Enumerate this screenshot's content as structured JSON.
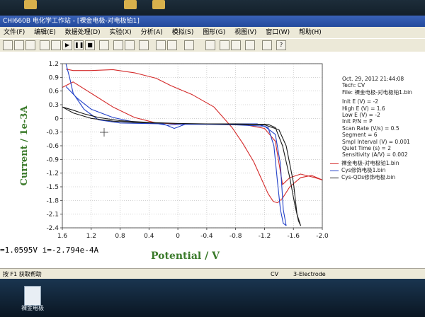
{
  "window": {
    "title": "CHI660B 电化学工作站 - [裸金电极-对电极铂1]",
    "menu": [
      "文件(F)",
      "编辑(E)",
      "数据处理(D)",
      "实验(X)",
      "分析(A)",
      "模拟(S)",
      "图形(G)",
      "视图(V)",
      "窗口(W)",
      "帮助(H)"
    ]
  },
  "info": {
    "date": "Oct. 29, 2012   21:44:08",
    "tech": "Tech: CV",
    "file": "File: 裸金电极-对电极铂1.bin",
    "params": [
      "Init E (V) = -2",
      "High E (V) = 1.6",
      "Low E (V) = -2",
      "Init P/N = P",
      "Scan Rate (V/s) = 0.5",
      "Segment = 6",
      "Smpl Interval (V) = 0.001",
      "Quiet Time (s) = 2",
      "Sensitivity (A/V) = 0.002"
    ]
  },
  "status": {
    "readout": "=1.0595V  i=-2.794e-4A",
    "help": "按 F1 获取帮助",
    "mode": "CV",
    "electrode": "3-Electrode"
  },
  "taskbar": {
    "item_label": "裸金电极"
  },
  "colors": {
    "red": "#d42a2a",
    "blue": "#2140c8",
    "black": "#1a1a1a",
    "axis_label": "#3a7a2a"
  },
  "chart_data": {
    "type": "line",
    "xlabel": "Potential / V",
    "ylabel": "Current / 1e-3A",
    "xlim": [
      1.6,
      -2.0
    ],
    "ylim": [
      -2.4,
      1.2
    ],
    "x_reversed": true,
    "grid": true,
    "xticks": [
      1.6,
      1.2,
      0.8,
      0.4,
      0,
      -0.4,
      -0.8,
      -1.2,
      -1.6,
      -2.0
    ],
    "xtick_labels": [
      "1.6",
      "1.2",
      "0.8",
      "0.4",
      "0",
      "-0.4",
      "-0.8",
      "-1.2",
      "-1.6",
      "-2.0"
    ],
    "yticks": [
      1.2,
      0.9,
      0.6,
      0.3,
      0,
      -0.3,
      -0.6,
      -0.9,
      -1.2,
      -1.5,
      -1.8,
      -2.1,
      -2.4
    ],
    "ytick_labels": [
      "1.2",
      "0.9",
      "0.6",
      "0.3",
      "0",
      "-0.3",
      "-0.6",
      "-0.9",
      "-1.2",
      "-1.5",
      "-1.8",
      "-2.1",
      "-2.4"
    ],
    "legend_position": "right",
    "series": [
      {
        "name": "裸金电极-对电极铂1.bin",
        "color": "#d42a2a",
        "x": [
          1.55,
          1.45,
          1.2,
          0.9,
          0.6,
          0.3,
          0.1,
          -0.2,
          -0.5,
          -0.75,
          -0.9,
          -1.05,
          -1.15,
          -1.25,
          -1.32,
          -1.38,
          -1.45,
          -1.55,
          -1.7,
          -1.85,
          -2.0,
          -1.9,
          -1.7,
          -1.55,
          -1.45,
          -1.35,
          -1.2,
          -0.9,
          -0.6,
          -0.3,
          0,
          0.3,
          0.6,
          0.9,
          1.2,
          1.45,
          1.6
        ],
        "y": [
          1.08,
          1.05,
          1.05,
          1.07,
          1.0,
          0.88,
          0.72,
          0.52,
          0.25,
          -0.2,
          -0.55,
          -0.95,
          -1.3,
          -1.65,
          -1.82,
          -1.85,
          -1.75,
          -1.5,
          -1.3,
          -1.25,
          -1.35,
          -1.3,
          -1.22,
          -1.3,
          -1.45,
          -0.5,
          -0.22,
          -0.13,
          -0.12,
          -0.12,
          -0.12,
          -0.1,
          0.02,
          0.25,
          0.55,
          0.8,
          0.68
        ]
      },
      {
        "name": "Cys修饰电极1.bin",
        "color": "#2140c8",
        "x": [
          1.55,
          1.5,
          1.45,
          1.3,
          1.1,
          0.8,
          0.5,
          0.2,
          0.05,
          -0.1,
          -0.4,
          -0.8,
          -1.1,
          -1.25,
          -1.33,
          -1.38,
          -1.42,
          -1.46,
          -1.5,
          -1.46,
          -1.42,
          -1.35,
          -1.2,
          -0.8,
          -0.4,
          0,
          0.15,
          0.3,
          0.6,
          0.9,
          1.2,
          1.4,
          1.55
        ],
        "y": [
          1.2,
          0.9,
          0.55,
          0.2,
          -0.03,
          -0.1,
          -0.11,
          -0.12,
          -0.22,
          -0.13,
          -0.12,
          -0.12,
          -0.12,
          -0.2,
          -0.6,
          -1.4,
          -2.0,
          -2.3,
          -2.35,
          -2.0,
          -1.0,
          -0.35,
          -0.17,
          -0.14,
          -0.13,
          -0.13,
          -0.15,
          -0.11,
          -0.08,
          0.02,
          0.2,
          0.45,
          0.7
        ]
      },
      {
        "name": "Cys-QDs修饰电极.bin",
        "color": "#1a1a1a",
        "x": [
          1.6,
          1.45,
          1.2,
          0.9,
          0.6,
          0.3,
          0,
          -0.4,
          -0.8,
          -1.1,
          -1.25,
          -1.35,
          -1.45,
          -1.55,
          -1.62,
          -1.67,
          -1.7,
          -1.65,
          -1.6,
          -1.5,
          -1.4,
          -1.2,
          -0.8,
          -0.4,
          0,
          0.4,
          0.8,
          1.1,
          1.3,
          1.45,
          1.6
        ],
        "y": [
          0.25,
          0.12,
          0.0,
          -0.06,
          -0.09,
          -0.1,
          -0.11,
          -0.12,
          -0.12,
          -0.13,
          -0.13,
          -0.2,
          -0.6,
          -1.3,
          -1.9,
          -2.25,
          -2.35,
          -2.1,
          -1.4,
          -0.6,
          -0.25,
          -0.14,
          -0.13,
          -0.12,
          -0.11,
          -0.09,
          -0.05,
          0.02,
          0.1,
          0.18,
          0.25
        ]
      }
    ]
  }
}
